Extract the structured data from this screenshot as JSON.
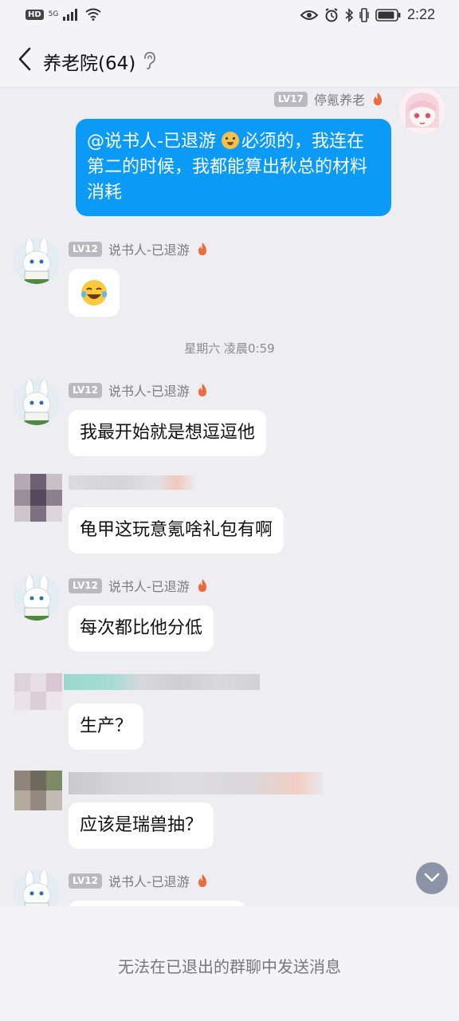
{
  "status_bar": {
    "hd": "HD",
    "network": "5G",
    "time": "2:22",
    "icons": [
      "signal-icon",
      "wifi-icon",
      "eye-icon",
      "alarm-icon",
      "bluetooth-icon",
      "vibrate-icon",
      "battery-icon"
    ]
  },
  "header": {
    "title": "养老院(64)",
    "icons": [
      "back-icon",
      "ear-icon"
    ]
  },
  "messages": [
    {
      "side": "out",
      "level": "LV17",
      "sender": "停氪养老",
      "text_parts": [
        "@说书人-已退游 ",
        "必须的，我连在第二的时候，我都能算出秋总的材料消耗"
      ],
      "emoji": "dog-face-emoji"
    },
    {
      "side": "in",
      "level": "LV12",
      "sender": "说书人-已退游",
      "emoji": "laughing-emoji"
    },
    {
      "side": "in",
      "level": "LV12",
      "sender": "说书人-已退游",
      "text": "我最开始就是想逗逗他"
    },
    {
      "side": "in",
      "text": "龟甲这玩意氪啥礼包有啊"
    },
    {
      "side": "in",
      "level": "LV12",
      "sender": "说书人-已退游",
      "text": "每次都比他分低"
    },
    {
      "side": "in",
      "text": "生产？"
    },
    {
      "side": "in",
      "text": "应该是瑞兽抽？"
    },
    {
      "side": "in",
      "level": "LV12",
      "sender": "说书人-已退游"
    }
  ],
  "timestamp": "星期六 凌晨0:59",
  "footer": {
    "text": "无法在已退出的群聊中发送消息"
  },
  "colors": {
    "accent": "#0b9af6",
    "background": "#ededf2",
    "bubble": "#ffffff",
    "level_badge": "#b9b9bf"
  }
}
